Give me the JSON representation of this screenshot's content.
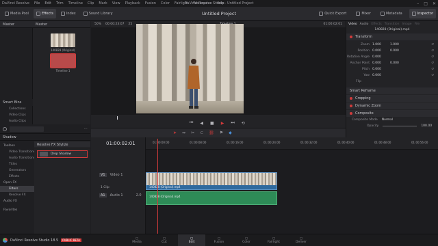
{
  "app": {
    "window_title": "DaVinci Resolve Studio - Untitled Project",
    "menu": [
      "DaVinci Resolve",
      "File",
      "Edit",
      "Trim",
      "Timeline",
      "Clip",
      "Mark",
      "View",
      "Playback",
      "Fusion",
      "Color",
      "Fairlight",
      "Workspace",
      "Help"
    ],
    "project_title": "Untitled Project",
    "brand": "DaVinci Resolve Studio 18.5",
    "beta_badge": "PUBLIC BETA",
    "accent": "#d23b3b"
  },
  "toolbar": {
    "left": [
      "Media Pool",
      "Effects",
      "Index",
      "Sound Library"
    ],
    "right": [
      "Quick Export",
      "Mixer",
      "Metadata",
      "Inspector"
    ]
  },
  "mediapool": {
    "master_label": "Master",
    "bins_title": "Master",
    "clips": [
      {
        "name": "140828 (Original)..."
      },
      {
        "name": "Timeline 1"
      }
    ],
    "smart_bins": "Smart Bins",
    "smart_bins_items": [
      "Collections",
      "Video Clips",
      "Audio Clips"
    ]
  },
  "effects": {
    "search_label": "Shadow",
    "tree": [
      {
        "label": "Toolbox",
        "head": true
      },
      {
        "label": "Video Transitions"
      },
      {
        "label": "Audio Transitions"
      },
      {
        "label": "Titles"
      },
      {
        "label": "Generators"
      },
      {
        "label": "Effects"
      },
      {
        "label": "Open FX",
        "head": true
      },
      {
        "label": "Filters",
        "selected": true
      },
      {
        "label": "Resolve FX"
      },
      {
        "label": "Audio FX",
        "head": true
      }
    ],
    "favorites": "Favorites",
    "group_title": "Resolve FX Stylize",
    "items": [
      "Drop Shadow"
    ]
  },
  "viewer": {
    "zoom": "50%",
    "source_tc": "00:00:23:07",
    "fps": "25",
    "timeline_name": "Timeline 1",
    "record_tc": "01:00:02:01"
  },
  "inspector": {
    "clip_name": "140828 (Original).mp4",
    "tabs": [
      "Video",
      "Audio",
      "Effects",
      "Transition",
      "Image",
      "File"
    ],
    "transform_label": "Transform",
    "rows": [
      {
        "label": "Zoom",
        "x": "1.000",
        "y": "1.000"
      },
      {
        "label": "Position",
        "x": "0.000",
        "y": "0.000"
      },
      {
        "label": "Rotation Angle",
        "x": "0.000",
        "y": ""
      },
      {
        "label": "Anchor Point",
        "x": "0.000",
        "y": "0.000"
      },
      {
        "label": "Pitch",
        "x": "0.000",
        "y": ""
      },
      {
        "label": "Yaw",
        "x": "0.000",
        "y": ""
      }
    ],
    "flip_label": "Flip",
    "sections": [
      "Smart Reframe",
      "Cropping",
      "Dynamic Zoom",
      "Composite"
    ],
    "composite_mode_label": "Composite Mode",
    "composite_mode_value": "Normal",
    "opacity_label": "Opacity",
    "opacity_value": "100.00"
  },
  "timeline": {
    "timecode": "01:00:02:01",
    "ruler": [
      "01:00:00:00",
      "01:00:08:00",
      "01:00:16:00",
      "01:00:24:00",
      "01:00:32:00",
      "01:00:40:00",
      "01:00:48:00",
      "01:00:56:00"
    ],
    "video_track": {
      "id": "V1",
      "name": "Video 1",
      "clips_label": "1 Clip"
    },
    "audio_track": {
      "id": "A1",
      "name": "Audio 1",
      "channels": "2.0"
    },
    "video_clip_name": "140828 (Original).mp4",
    "audio_clip_name": "140828 (Original).mp4"
  },
  "pages": [
    {
      "label": "Media"
    },
    {
      "label": "Cut"
    },
    {
      "label": "Edit",
      "active": true
    },
    {
      "label": "Fusion"
    },
    {
      "label": "Color"
    },
    {
      "label": "Fairlight"
    },
    {
      "label": "Deliver"
    }
  ]
}
